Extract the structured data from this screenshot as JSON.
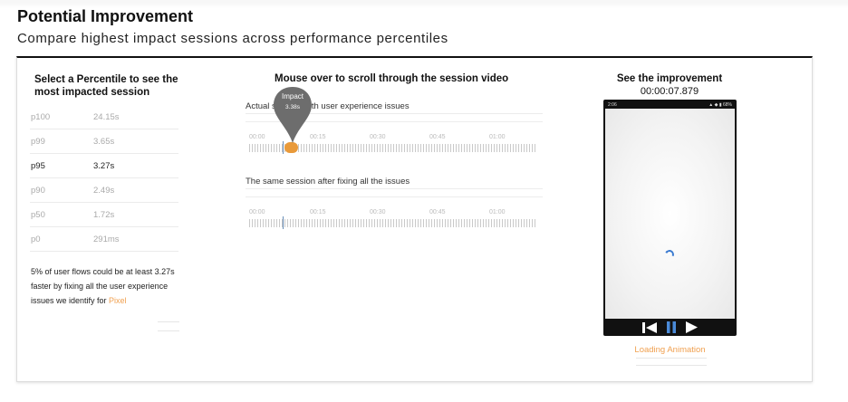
{
  "header": {
    "title": "Potential Improvement",
    "subtitle": "Compare highest impact sessions across performance percentiles"
  },
  "left_panel": {
    "title": "Select a Percentile to see the most impacted session",
    "percentiles": [
      {
        "label": "p100",
        "value": "24.15s",
        "active": false
      },
      {
        "label": "p99",
        "value": "3.65s",
        "active": false
      },
      {
        "label": "p95",
        "value": "3.27s",
        "active": true
      },
      {
        "label": "p90",
        "value": "2.49s",
        "active": false
      },
      {
        "label": "p50",
        "value": "1.72s",
        "active": false
      },
      {
        "label": "p0",
        "value": "291ms",
        "active": false
      }
    ],
    "note_text": "5% of user flows could be at least 3.27s faster by fixing all the user experience issues we identify for ",
    "note_link": "Pixel"
  },
  "middle_panel": {
    "title": "Mouse over to scroll through the session video",
    "actual_label": "Actual session with user experience issues",
    "fixed_label": "The same session after fixing all the issues",
    "tick_labels": [
      "00:00",
      "00:15",
      "00:30",
      "00:45",
      "01:00"
    ],
    "impact_pin": {
      "label": "Impact",
      "value": "3.38s"
    }
  },
  "right_panel": {
    "title": "See the improvement",
    "timestamp": "00:00:07.879",
    "phone_status_time": "2:06",
    "phone_status_icons": "▲ ◆ ▮ 68%",
    "caption": "Loading Animation"
  },
  "colors": {
    "accent_orange": "#e99a3a",
    "link_orange": "#f0a050",
    "marker_blue": "#6a8fb8",
    "spinner_blue": "#3a7ad0"
  }
}
